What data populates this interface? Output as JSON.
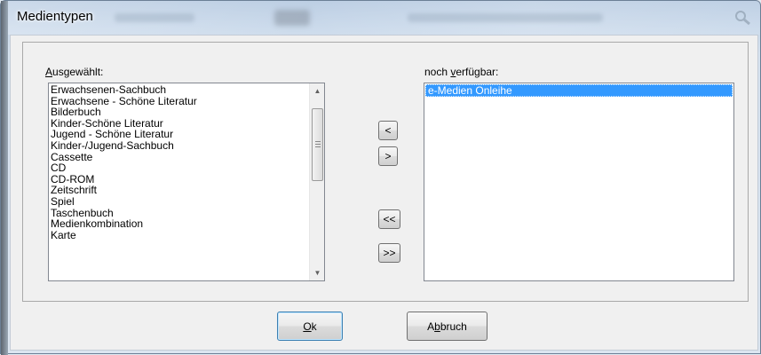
{
  "window": {
    "title": "Medientypen"
  },
  "left_list": {
    "label": "Ausgewählt:",
    "items": [
      "Erwachsenen-Sachbuch",
      "Erwachsene - Schöne Literatur",
      "Bilderbuch",
      "Kinder-Schöne Literatur",
      "Jugend - Schöne Literatur",
      "Kinder-/Jugend-Sachbuch",
      "Cassette",
      "CD",
      "CD-ROM",
      "Zeitschrift",
      "Spiel",
      "Taschenbuch",
      "Medienkombination",
      "Karte"
    ]
  },
  "right_list": {
    "label": "noch verfügbar:",
    "items": [
      "e-Medien Onleihe"
    ],
    "selected_index": 0
  },
  "move_buttons": {
    "add_selected": "<",
    "remove_selected": ">",
    "add_all": "<<",
    "remove_all": ">>"
  },
  "dialog_buttons": {
    "ok": "Ok",
    "cancel": "Abbruch"
  },
  "colors": {
    "selection": "#3399ff",
    "default_button_border": "#3c7fb1"
  }
}
